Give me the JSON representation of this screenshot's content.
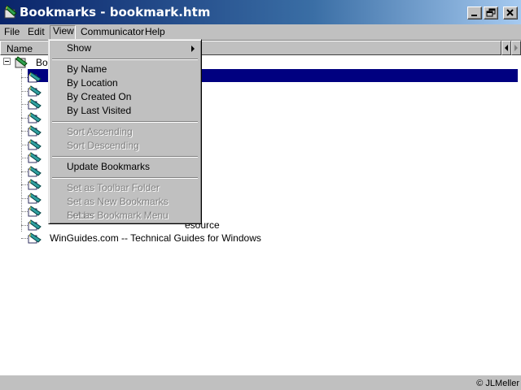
{
  "window": {
    "title": "Bookmarks - bookmark.htm",
    "icons": [
      "bookmarks-app-icon",
      "minimize-icon",
      "restore-icon",
      "close-icon"
    ]
  },
  "menubar": {
    "items": [
      "File",
      "Edit",
      "View",
      "Communicator",
      "Help"
    ],
    "active": "View"
  },
  "column_header": {
    "name": "Name"
  },
  "tree": {
    "root_label": "Bo",
    "bookmarks": [
      {
        "label": ""
      },
      {
        "label": ""
      },
      {
        "label": ""
      },
      {
        "label": ""
      },
      {
        "label": ""
      },
      {
        "label": ""
      },
      {
        "label": ""
      },
      {
        "label": ""
      },
      {
        "label": ""
      },
      {
        "label": ""
      },
      {
        "label": ""
      },
      {
        "label": "esource"
      },
      {
        "label": "WinGuides.com -- Technical Guides for Windows"
      }
    ]
  },
  "view_menu": {
    "show": "Show",
    "sort_by_name": "By Name",
    "sort_by_location": "By Location",
    "sort_by_created": "By Created On",
    "sort_by_visited": "By Last Visited",
    "sort_ascending": "Sort Ascending",
    "sort_descending": "Sort Descending",
    "update_bookmarks": "Update Bookmarks",
    "set_toolbar_folder": "Set as Toolbar Folder",
    "set_new_bookmarks_folder": "Set as New Bookmarks Folder",
    "set_bookmark_menu": "Set as Bookmark Menu"
  },
  "status": {
    "copyright": "© JLMeller"
  },
  "colors": {
    "title_bar": "#0a246a",
    "selection": "#000080",
    "face": "#c0c0c0"
  }
}
